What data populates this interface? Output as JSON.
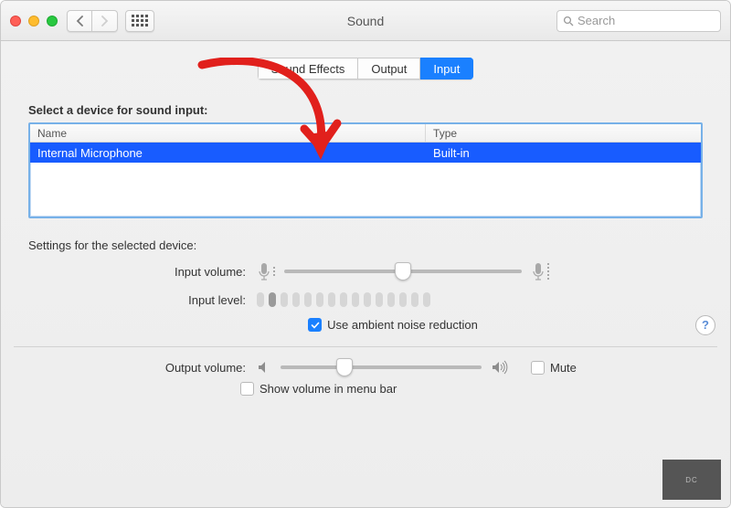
{
  "titlebar": {
    "title": "Sound",
    "search_placeholder": "Search"
  },
  "tabs": [
    {
      "label": "Sound Effects",
      "active": false
    },
    {
      "label": "Output",
      "active": false
    },
    {
      "label": "Input",
      "active": true
    }
  ],
  "input_section": {
    "heading": "Select a device for sound input:",
    "columns": {
      "name": "Name",
      "type": "Type"
    },
    "devices": [
      {
        "name": "Internal Microphone",
        "type": "Built-in",
        "selected": true
      }
    ]
  },
  "settings": {
    "heading": "Settings for the selected device:",
    "input_volume_label": "Input volume:",
    "input_volume_percent": 50,
    "input_level_label": "Input level:",
    "input_level_active_index": 1,
    "input_level_total": 15,
    "ambient_noise": {
      "label": "Use ambient noise reduction",
      "checked": true
    }
  },
  "output": {
    "label": "Output volume:",
    "percent": 32,
    "mute": {
      "label": "Mute",
      "checked": false
    },
    "show_menubar": {
      "label": "Show volume in menu bar",
      "checked": false
    }
  },
  "help_label": "?",
  "badge": "DC"
}
